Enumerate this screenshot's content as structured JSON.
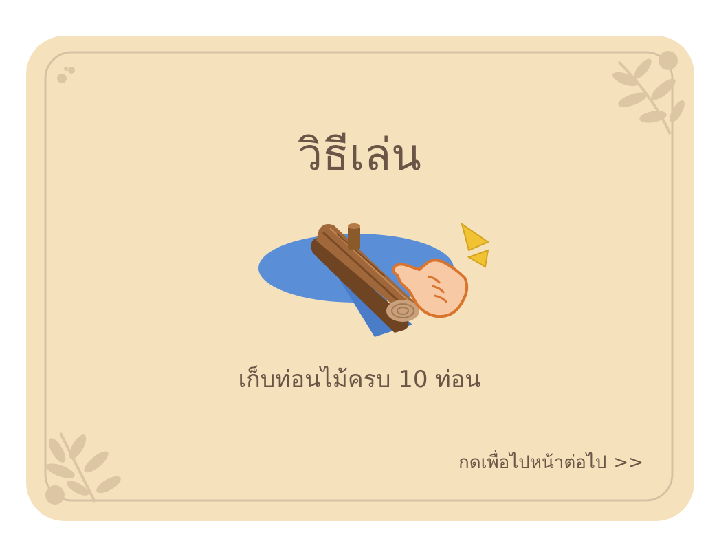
{
  "screen": {
    "title": "วิธีเล่น",
    "instruction": "เก็บท่อนไม้ครบ 10 ท่อน",
    "next_label": "กดเพื่อไปหน้าต่อไป",
    "next_arrows": ">>"
  },
  "illustration": {
    "icons": [
      "pond-icon",
      "log-icon",
      "tap-hand-icon",
      "sparkle-icon"
    ]
  },
  "colors": {
    "background": "#f5e2bd",
    "frame": "#d8c1a3",
    "text": "#6b5546",
    "pond": "#5a8fd8",
    "log": "#8b5a2b",
    "sparkle": "#f1c232"
  }
}
